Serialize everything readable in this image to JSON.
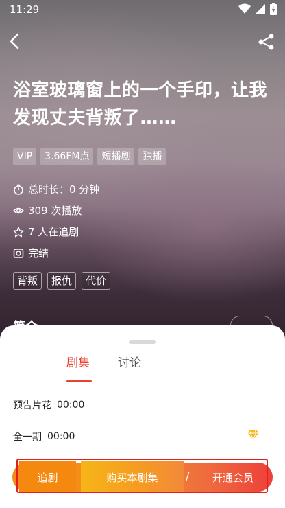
{
  "status_bar": {
    "time": "11:29"
  },
  "drama": {
    "title": "浴室玻璃窗上的一个手印，让我发现丈夫背叛了……",
    "tags": [
      "VIP",
      "3.66FM点",
      "短播剧",
      "独播"
    ],
    "duration": "总时长：0 分钟",
    "plays": "309 次播放",
    "followers": "7 人在追剧",
    "status": "完结",
    "keywords": [
      "背叛",
      "报仇",
      "代价"
    ],
    "intro_heading": "简介"
  },
  "sheet": {
    "tabs": [
      {
        "label": "剧集",
        "active": true
      },
      {
        "label": "讨论",
        "active": false
      }
    ],
    "episodes": [
      {
        "name": "预告片花",
        "duration": "00:00"
      },
      {
        "name": "全一期",
        "duration": "00:00",
        "icon": "diamond-icon"
      }
    ]
  },
  "actions": {
    "follow": "追剧",
    "buy": "购买本剧集",
    "separator": "/",
    "vip": "开通会员"
  },
  "colors": {
    "accent": "#e8432f",
    "orange": "#f5890f",
    "highlight": "#e02020"
  }
}
